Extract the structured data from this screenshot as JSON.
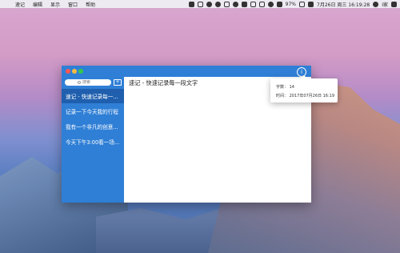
{
  "menubar": {
    "apple_glyph": "",
    "items": [
      "速记",
      "编辑",
      "显示",
      "窗口",
      "帮助"
    ],
    "battery": "97%",
    "datetime": "7月26日 周三 16:19:28",
    "user": "I家"
  },
  "sidebar": {
    "search_placeholder": "搜索",
    "add_label": "+",
    "notes": [
      "速记 - 快速记录每一...",
      "记录一下今天我的行程",
      "我有一个非凡的创意...",
      "今天下午3:00看一场..."
    ]
  },
  "editor": {
    "text": "速记 - 快速记录每一段文字"
  },
  "info_button": {
    "glyph": "i"
  },
  "popover": {
    "word_count": "字数： 14",
    "time": "时间： 2017年07月26日 16:19"
  },
  "colors": {
    "accent": "#2f7fd6",
    "selected": "#1f5fae"
  }
}
